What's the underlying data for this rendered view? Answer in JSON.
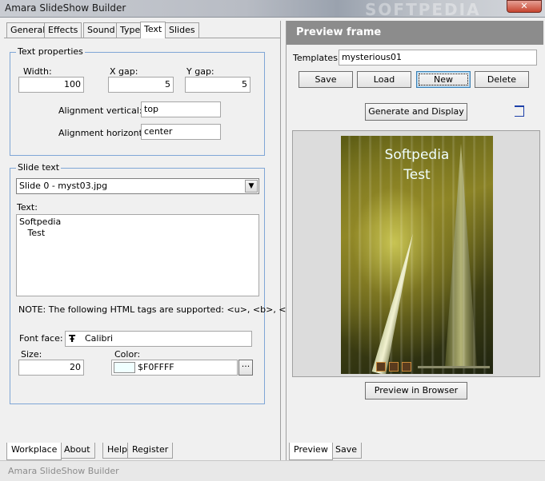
{
  "window": {
    "title": "Amara SlideShow Builder",
    "watermark": "SOFTPEDIA",
    "close_glyph": "✕",
    "status_title": "Amara SlideShow Builder"
  },
  "left": {
    "tabs": [
      "General",
      "Effects",
      "Sound",
      "Type",
      "Text",
      "Slides"
    ],
    "active_tab": "Text",
    "text_properties": {
      "legend": "Text properties",
      "width_label": "Width:",
      "width_value": "100",
      "xgap_label": "X gap:",
      "xgap_value": "5",
      "ygap_label": "Y gap:",
      "ygap_value": "5",
      "align_v_label": "Alignment vertical:",
      "align_v_value": "top",
      "align_h_label": "Alignment horizontal:",
      "align_h_value": "center"
    },
    "slide_text": {
      "legend": "Slide text",
      "slide_select": "Slide 0 - myst03.jpg",
      "text_label": "Text:",
      "text_lines": [
        "Softpedia",
        "   Test"
      ],
      "note": "NOTE: The following HTML tags are supported: <u>, <b>, <i>",
      "font_face_label": "Font face:",
      "font_face_value": "Calibri",
      "size_label": "Size:",
      "size_value": "20",
      "color_label": "Color:",
      "color_value": "$F0FFFF",
      "color_swatch": "#F0FFFF",
      "ellipsis": "···"
    },
    "bottom_tabs": [
      "Workplace",
      "About us",
      "Help",
      "Register"
    ],
    "active_bottom_tab": "Workplace"
  },
  "right": {
    "header": "Preview frame",
    "templates_label": "Templates:",
    "templates_value": "mysterious01",
    "buttons": {
      "save": "Save",
      "load": "Load",
      "new": "New",
      "delete": "Delete"
    },
    "generate_button": "Generate and Display",
    "preview_text_lines": [
      "Softpedia",
      "Test"
    ],
    "preview_browser_button": "Preview in Browser",
    "bottom_tabs": [
      "Preview",
      "Save"
    ],
    "active_bottom_tab": "Preview"
  }
}
